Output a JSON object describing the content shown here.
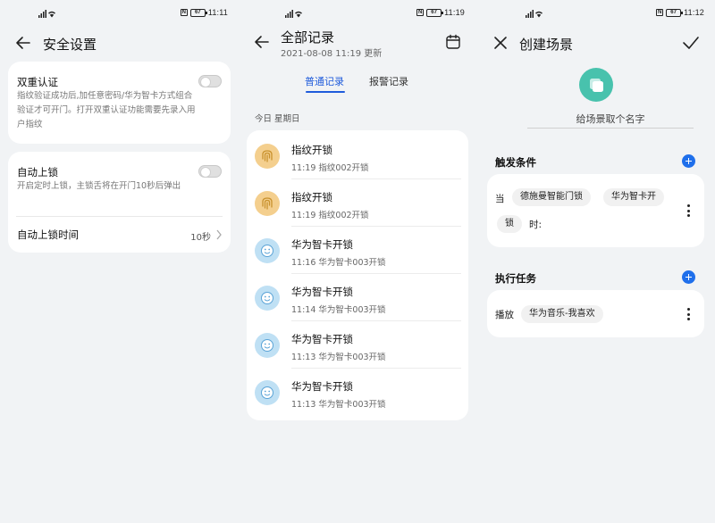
{
  "status_bar": {
    "screen1_time": "11:11",
    "screen2_time": "11:19",
    "screen3_time": "11:12",
    "battery": "67",
    "nfc": "N"
  },
  "screen1": {
    "title": "安全设置",
    "dual_auth": {
      "title": "双重认证",
      "description": "指纹验证成功后,加任意密码/华为智卡方式组合验证才可开门。打开双重认证功能需要先录入用户指纹",
      "enabled": false
    },
    "auto_lock": {
      "title": "自动上锁",
      "description": "开启定时上锁，主锁舌将在开门10秒后弹出",
      "enabled": false
    },
    "auto_lock_time": {
      "label": "自动上锁时间",
      "value": "10秒"
    }
  },
  "screen2": {
    "title": "全部记录",
    "subtitle": "2021-08-08 11:19 更新",
    "tabs": [
      {
        "label": "普通记录",
        "active": true
      },
      {
        "label": "报警记录",
        "active": false
      }
    ],
    "date_label": "今日 星期日",
    "records": [
      {
        "type": "fingerprint",
        "icon": "fingerprint-icon",
        "name": "指纹开锁",
        "detail": "11:19 指纹002开锁"
      },
      {
        "type": "fingerprint",
        "icon": "fingerprint-icon",
        "name": "指纹开锁",
        "detail": "11:19 指纹002开锁"
      },
      {
        "type": "card",
        "icon": "smiley-card-icon",
        "name": "华为智卡开锁",
        "detail": "11:16 华为智卡003开锁"
      },
      {
        "type": "card",
        "icon": "smiley-card-icon",
        "name": "华为智卡开锁",
        "detail": "11:14 华为智卡003开锁"
      },
      {
        "type": "card",
        "icon": "smiley-card-icon",
        "name": "华为智卡开锁",
        "detail": "11:13 华为智卡003开锁"
      },
      {
        "type": "card",
        "icon": "smiley-card-icon",
        "name": "华为智卡开锁",
        "detail": "11:13 华为智卡003开锁"
      }
    ]
  },
  "screen3": {
    "title": "创建场景",
    "name_placeholder": "给场景取个名字",
    "trigger_section": "触发条件",
    "trigger": {
      "prefix": "当",
      "chip_device": "德施曼智能门锁",
      "chip_event_part1": "华为智卡开",
      "chip_event_part2": "锁",
      "suffix": "时:"
    },
    "action_section": "执行任务",
    "action": {
      "prefix": "播放",
      "chip": "华为音乐-我喜欢"
    }
  },
  "colors": {
    "accent": "#1f5bdb",
    "scene_icon": "#48c2ad",
    "background": "#f1f3f5"
  }
}
